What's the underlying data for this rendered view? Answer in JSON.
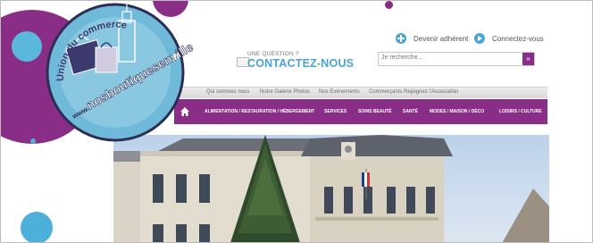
{
  "top_links": {
    "adherent": "Devenir adhérent",
    "connect": "Connectez-vous"
  },
  "contact": {
    "question": "UNE QUESTION ?",
    "label": "CONTACTEZ-NOUS"
  },
  "search": {
    "placeholder": "Je recherche...",
    "button": "»"
  },
  "subnav": {
    "items": [
      "Qui sommes nous",
      "Notre Galerie Photos",
      "Nos Evènements",
      "Commerçants Rejoignez l'Association"
    ]
  },
  "mainnav": {
    "items": [
      "ALIMENTATION / RESTAURATION / HÉBERGEMENT",
      "SERVICES",
      "SOINS BEAUTÉ",
      "SANTÉ",
      "MODES / MAISON / DÉCO",
      "LOISIRS / CULTURE"
    ]
  },
  "logo": {
    "top_arc": "Union du commerce",
    "url_left": "www.",
    "url_main": "nosboutiquesenville",
    "url_tld": ".fr"
  },
  "colors": {
    "purple": "#8a2d86",
    "teal": "#4db0da",
    "contact_blue": "#49a4d3"
  }
}
